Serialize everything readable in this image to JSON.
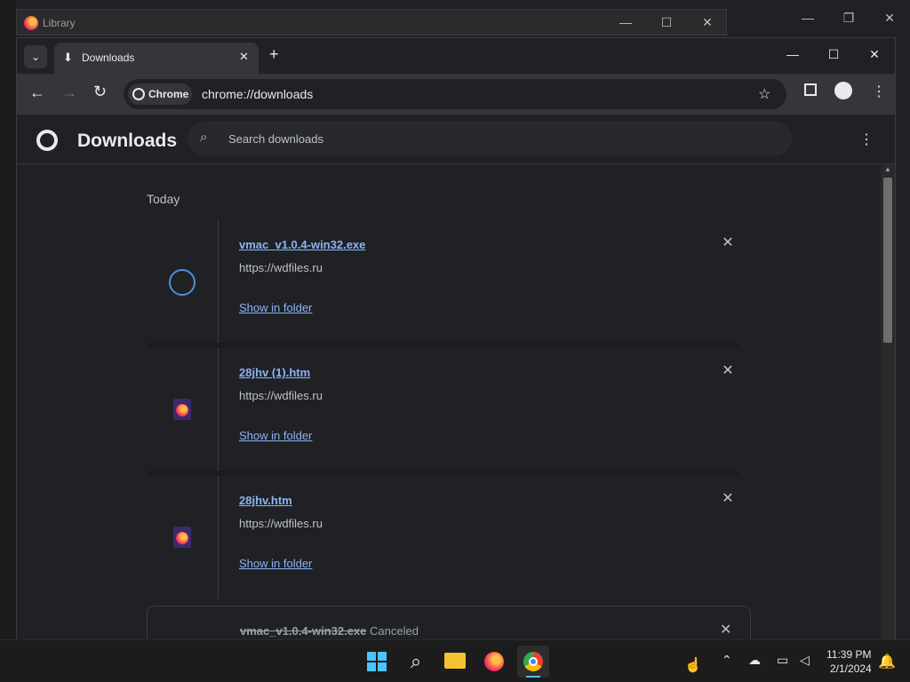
{
  "library": {
    "title": "Library"
  },
  "tab": {
    "title": "Downloads"
  },
  "omnibox": {
    "chip": "Chrome",
    "url": "chrome://downloads"
  },
  "page": {
    "title": "Downloads",
    "search_placeholder": "Search downloads",
    "section": "Today"
  },
  "downloads": [
    {
      "name": "vmac_v1.0.4-win32.exe",
      "source": "https://wdfiles.ru",
      "action": "Show in folder"
    },
    {
      "name": "28jhv (1).htm",
      "source": "https://wdfiles.ru",
      "action": "Show in folder"
    },
    {
      "name": "28jhv.htm",
      "source": "https://wdfiles.ru",
      "action": "Show in folder"
    },
    {
      "name": "vmac_v1.0.4-win32.exe",
      "status": "Canceled"
    }
  ],
  "taskbar": {
    "time": "11:39 PM",
    "date": "2/1/2024"
  },
  "colors": {
    "link": "#8ab4f8",
    "bg": "#202124",
    "toolbar": "#35363a"
  },
  "icons": [
    "firefox-icon",
    "download-icon",
    "back-icon",
    "forward-icon",
    "reload-icon",
    "chrome-icon",
    "star-icon",
    "sidepanel-icon",
    "profile-icon",
    "menu-icon",
    "search-icon",
    "close-icon",
    "windows-start-icon",
    "file-explorer-icon",
    "bell-icon"
  ]
}
